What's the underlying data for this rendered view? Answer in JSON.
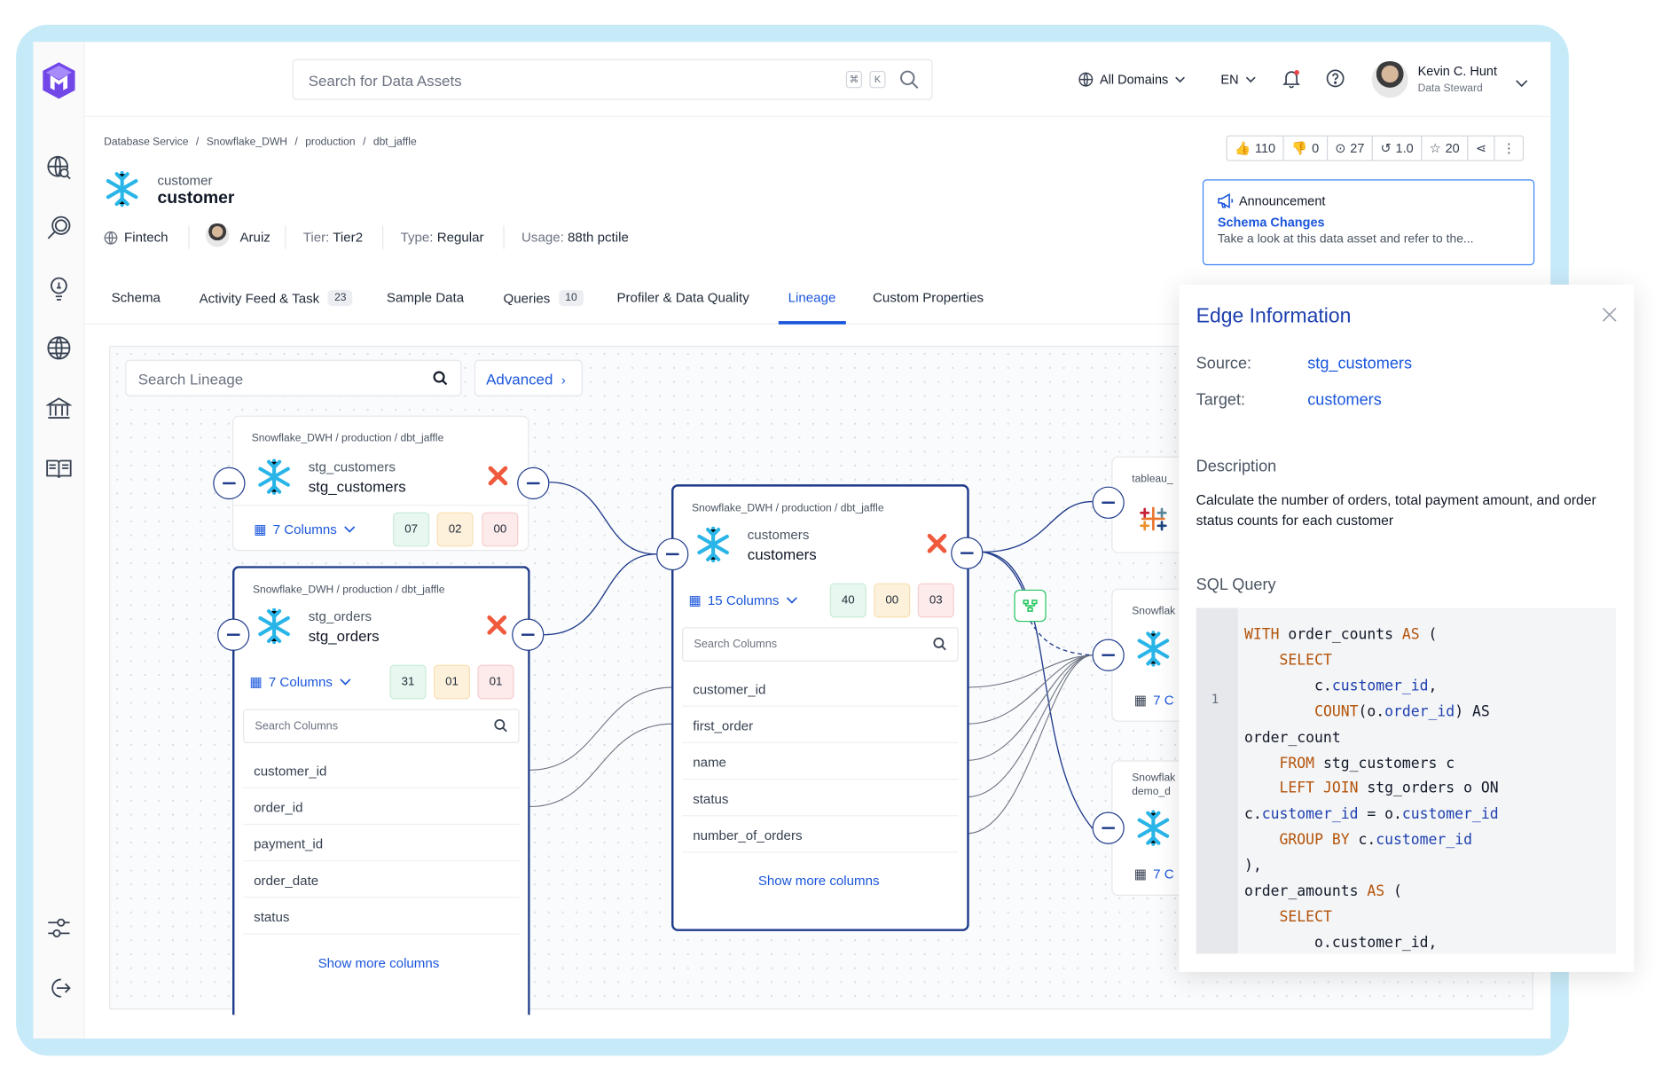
{
  "app": {
    "logo": "openmetadata-logo"
  },
  "search": {
    "placeholder": "Search for Data Assets",
    "kbd1": "⌘",
    "kbd2": "K"
  },
  "topbar": {
    "domains": "All Domains",
    "language": "EN",
    "user_name": "Kevin C. Hunt",
    "user_role": "Data Steward"
  },
  "breadcrumb": [
    "Database Service",
    "Snowflake_DWH",
    "production",
    "dbt_jaffle"
  ],
  "stats": {
    "likes": "110",
    "dislikes": "0",
    "views": "27",
    "version": "1.0",
    "stars": "20"
  },
  "entity": {
    "name_small": "customer",
    "name": "customer",
    "domain": "Fintech",
    "owner": "Aruiz",
    "tier_label": "Tier:",
    "tier": "Tier2",
    "type_label": "Type:",
    "type": "Regular",
    "usage_label": "Usage:",
    "usage": "88th pctile"
  },
  "announcement": {
    "header": "Announcement",
    "title": "Schema Changes",
    "body": "Take a look at this data asset and refer to the..."
  },
  "tabs": [
    {
      "label": "Schema"
    },
    {
      "label": "Activity Feed & Task",
      "count": "23"
    },
    {
      "label": "Sample Data"
    },
    {
      "label": "Queries",
      "count": "10"
    },
    {
      "label": "Profiler & Data Quality"
    },
    {
      "label": "Lineage",
      "active": true
    },
    {
      "label": "Custom Properties"
    }
  ],
  "lineage": {
    "search_placeholder": "Search Lineage",
    "advanced": "Advanced",
    "nodes": {
      "stg_customers": {
        "path": "Snowflake_DWH / production / dbt_jaffle",
        "name_small": "stg_customers",
        "name": "stg_customers",
        "columns": "7 Columns",
        "b1": "07",
        "b2": "02",
        "b3": "00"
      },
      "stg_orders": {
        "path": "Snowflake_DWH / production / dbt_jaffle",
        "name_small": "stg_orders",
        "name": "stg_orders",
        "columns": "7 Columns",
        "b1": "31",
        "b2": "01",
        "b3": "01",
        "search": "Search Columns",
        "rows": [
          "customer_id",
          "order_id",
          "payment_id",
          "order_date",
          "status"
        ],
        "more": "Show more columns"
      },
      "customers": {
        "path": "Snowflake_DWH / production / dbt_jaffle",
        "name_small": "customers",
        "name": "customers",
        "columns": "15 Columns",
        "b1": "40",
        "b2": "00",
        "b3": "03",
        "search": "Search Columns",
        "rows": [
          "customer_id",
          "first_order",
          "name",
          "status",
          "number_of_orders"
        ],
        "more": "Show more columns"
      },
      "right1": {
        "path": "tableau_"
      },
      "right2": {
        "path": "Snowflak",
        "columns": "7 C"
      },
      "right3": {
        "path": "Snowflak",
        "path2": "demo_d",
        "columns": "7 C"
      }
    }
  },
  "edge_panel": {
    "title": "Edge Information",
    "source_label": "Source:",
    "source": "stg_customers",
    "target_label": "Target:",
    "target": "customers",
    "description_label": "Description",
    "description": "Calculate the number of orders, total payment amount, and order status counts for each customer",
    "sql_label": "SQL Query",
    "line_number": "1"
  },
  "colors": {
    "accent": "#1a56db",
    "navy": "#1e3a8a",
    "snowflake": "#29b5e8",
    "frame": "#c7eaf8"
  }
}
